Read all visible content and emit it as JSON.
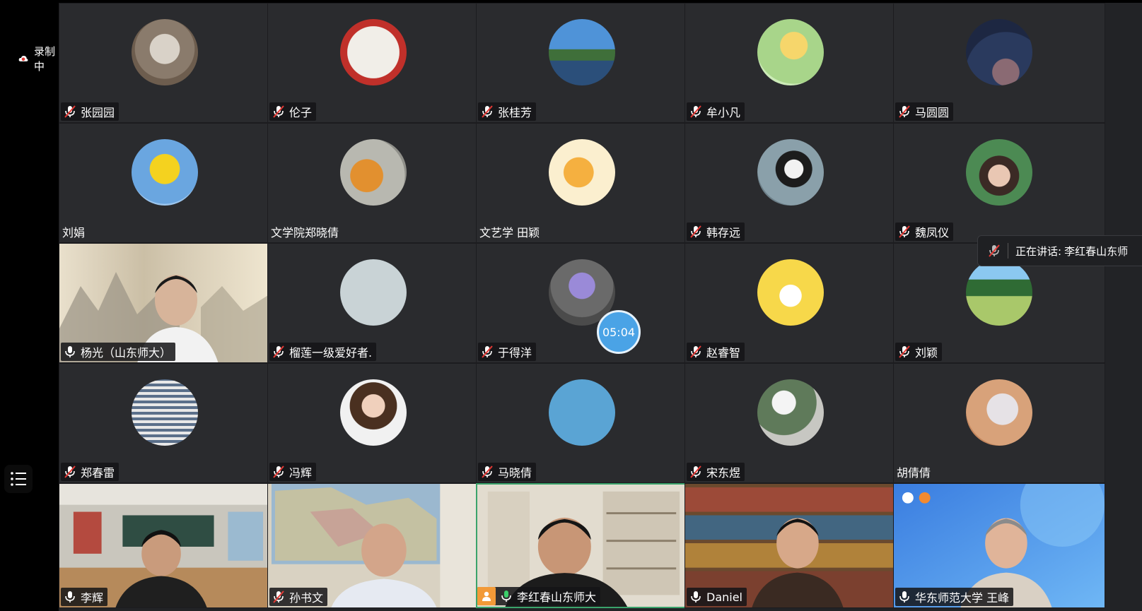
{
  "recording": {
    "label": "录制中"
  },
  "speaking": {
    "label": "正在讲话:",
    "name": "李红春山东师"
  },
  "timer": {
    "value": "05:04"
  },
  "participants": [
    {
      "name": "张园园"
    },
    {
      "name": "伦子"
    },
    {
      "name": "张桂芳"
    },
    {
      "name": "牟小凡"
    },
    {
      "name": "马圆圆"
    },
    {
      "name": "刘娟"
    },
    {
      "name": "文学院郑晓倩"
    },
    {
      "name": "文艺学 田颖"
    },
    {
      "name": "韩存远"
    },
    {
      "name": "魏凤仪"
    },
    {
      "name": "杨光（山东师大）"
    },
    {
      "name": "榴莲一级爱好者."
    },
    {
      "name": "于得洋"
    },
    {
      "name": "赵睿智"
    },
    {
      "name": "刘颖"
    },
    {
      "name": "郑春雷"
    },
    {
      "name": "冯辉"
    },
    {
      "name": "马晓倩"
    },
    {
      "name": "宋东煜"
    },
    {
      "name": "胡倩倩"
    },
    {
      "name": "李辉"
    },
    {
      "name": "孙书文"
    },
    {
      "name": "李红春山东师大"
    },
    {
      "name": "Daniel"
    },
    {
      "name": "华东师范大学 王峰"
    }
  ]
}
